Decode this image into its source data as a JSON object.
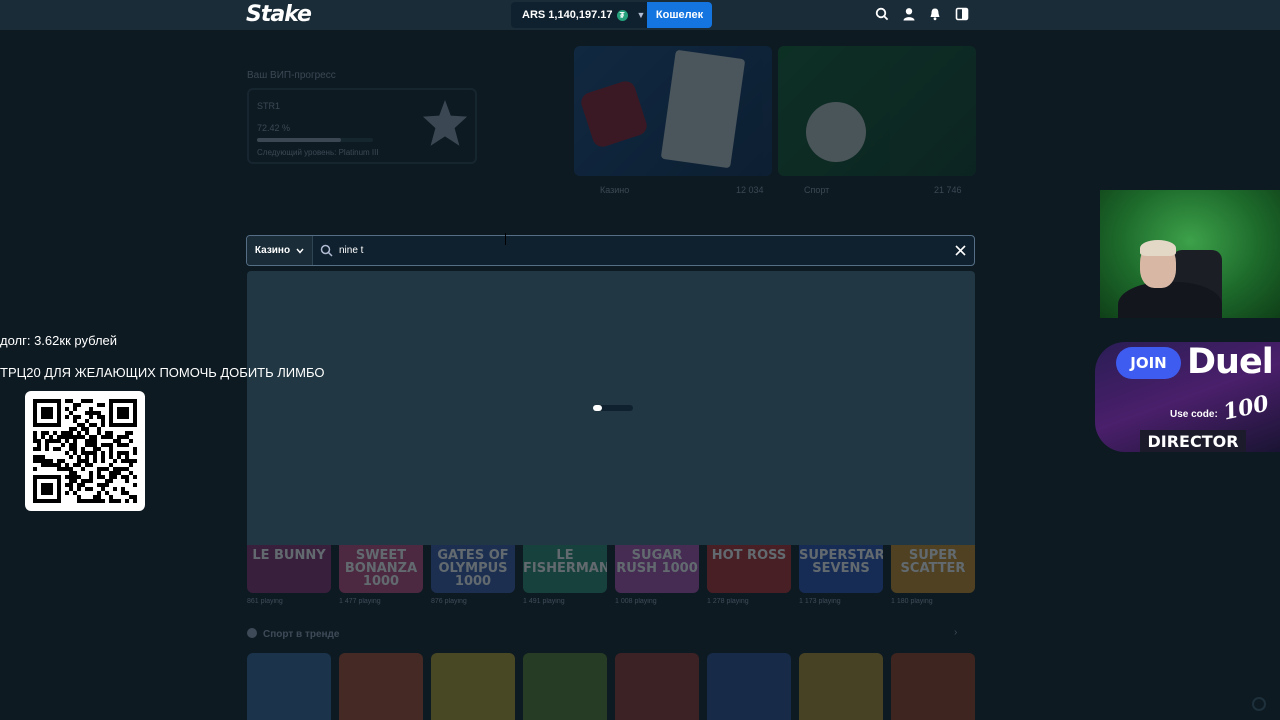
{
  "header": {
    "logo": "Stake",
    "balance": "ARS 1,140,197.17",
    "currency_symbol": "₮",
    "wallet_label": "Кошелек"
  },
  "vip": {
    "title": "Ваш ВИП-прогресс",
    "level": "STR1",
    "progress_text": "72.42 %",
    "progress": 0.7242,
    "next_level": "Следующий уровень: Platinum III"
  },
  "promos": [
    {
      "label": "Казино",
      "count": "12 034"
    },
    {
      "label": "Спорт",
      "count": "21 746"
    }
  ],
  "search": {
    "category": "Казино",
    "value": "nine t"
  },
  "games": [
    {
      "title": "LE BUNNY",
      "players": "861 playing",
      "color": "#8a2a6c"
    },
    {
      "title": "SWEET BONANZA 1000",
      "players": "1 477 playing",
      "color": "#c2457a"
    },
    {
      "title": "GATES OF OLYMPUS 1000",
      "players": "876 playing",
      "color": "#3a58a8"
    },
    {
      "title": "LE FISHERMAN",
      "players": "1 491 playing",
      "color": "#2c8a6c"
    },
    {
      "title": "SUGAR RUSH 1000",
      "players": "1 008 playing",
      "color": "#b04db0"
    },
    {
      "title": "HOT ROSS",
      "players": "1 278 playing",
      "color": "#b22a2a"
    },
    {
      "title": "SUPERSTAR SEVENS",
      "players": "1 173 playing",
      "color": "#2b4fb4"
    },
    {
      "title": "SUPER SCATTER",
      "players": "1 180 playing",
      "color": "#c98a22"
    }
  ],
  "sports_title": "Спорт в тренде",
  "sports": [
    "#3a6fb0",
    "#c74b2a",
    "#d4b42a",
    "#5f8c2a",
    "#a8342a",
    "#3050a0",
    "#d0a030",
    "#b0401a"
  ],
  "overlay": {
    "debt": "долг: 3.62кк рублей",
    "appeal": "ТРЦ20 ДЛЯ ЖЕЛАЮЩИХ ПОМОЧЬ ДОБИТЬ ЛИМБО"
  },
  "duel_ad": {
    "join": "JOIN",
    "brand": "Duel",
    "use_code": "Use code:",
    "bonus": "100",
    "code": "DIRECTOR"
  }
}
